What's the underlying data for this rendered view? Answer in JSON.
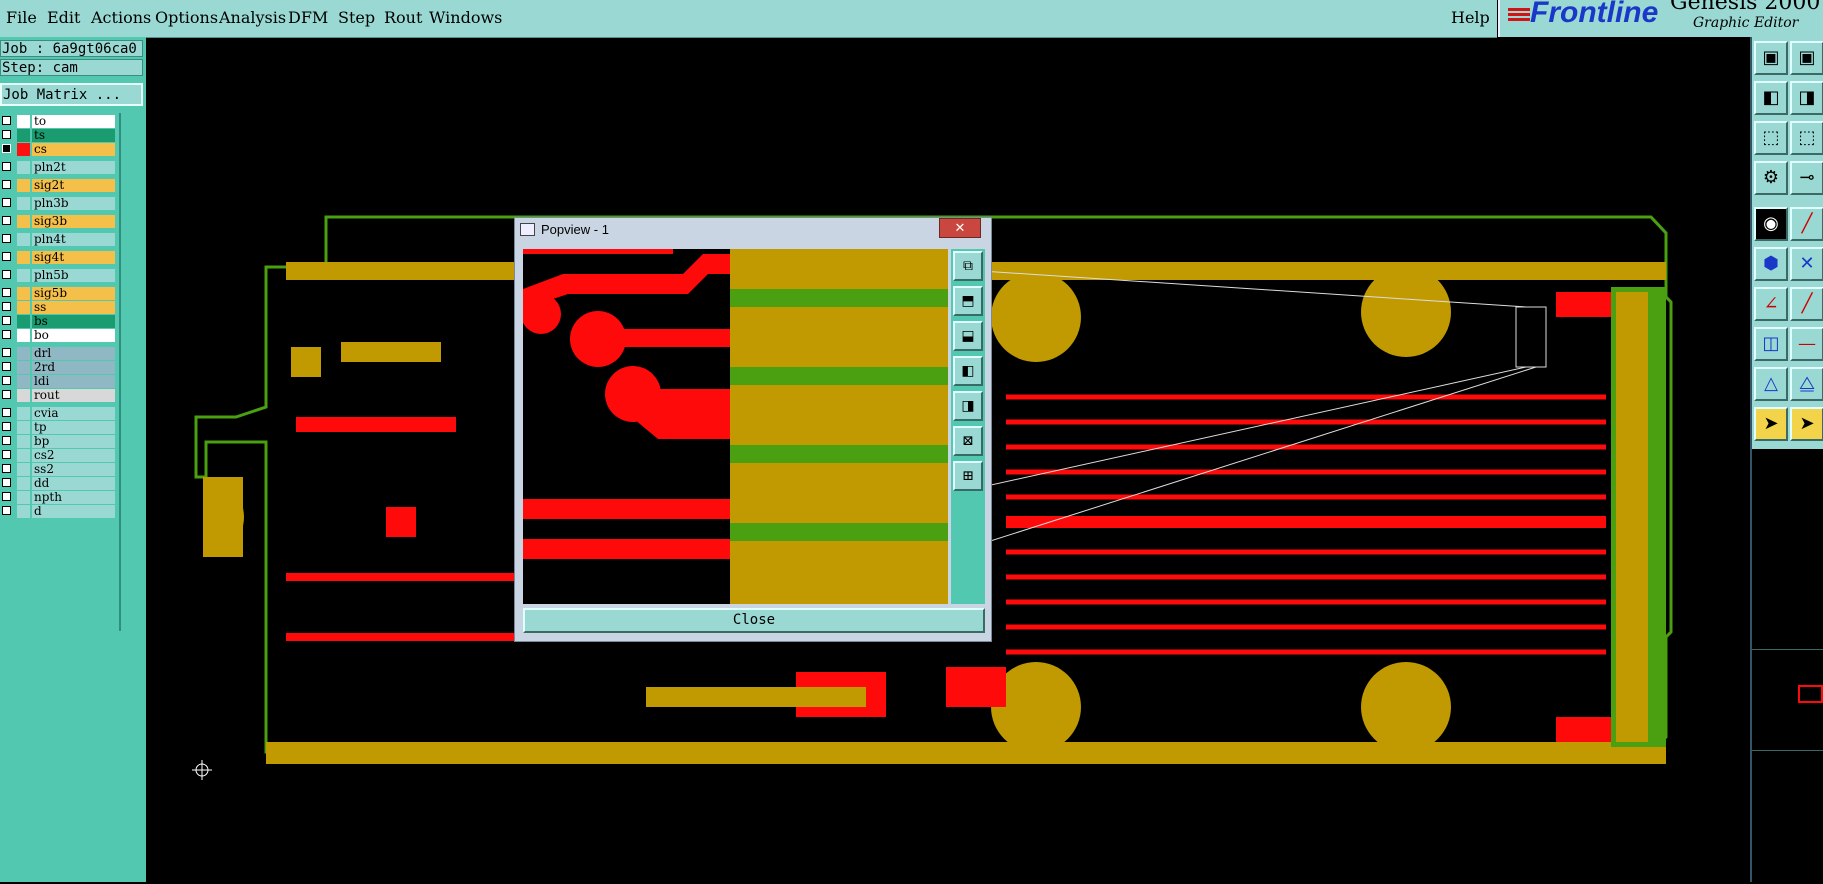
{
  "menu": {
    "items": [
      "File",
      "Edit",
      "Actions",
      "Options",
      "Analysis",
      "DFM",
      "Step",
      "Rout",
      "Windows"
    ],
    "help": "Help"
  },
  "logo": {
    "brand": "Frontline",
    "product": "Genesis 2000",
    "subtitle": "Graphic Editor"
  },
  "job": {
    "job_label": "Job : 6a9gt06ca0",
    "step_label": "Step: cam",
    "matrix_button": "Job Matrix ..."
  },
  "layers": [
    {
      "name": "to",
      "bg": "#ffffff",
      "swatch": "",
      "checked": false
    },
    {
      "name": "ts",
      "bg": "#1a9c70",
      "swatch": "#1a9c70",
      "checked": false
    },
    {
      "name": "cs",
      "bg": "#f5c04a",
      "swatch": "#ff1010",
      "checked": true
    },
    {
      "name": "pln2t",
      "bg": "#9ad9d3",
      "swatch": "",
      "checked": false
    },
    {
      "name": "sig2t",
      "bg": "#f5c04a",
      "swatch": "",
      "checked": false
    },
    {
      "name": "pln3b",
      "bg": "#9ad9d3",
      "swatch": "",
      "checked": false
    },
    {
      "name": "sig3b",
      "bg": "#f5c04a",
      "swatch": "",
      "checked": false
    },
    {
      "name": "pln4t",
      "bg": "#9ad9d3",
      "swatch": "",
      "checked": false
    },
    {
      "name": "sig4t",
      "bg": "#f5c04a",
      "swatch": "",
      "checked": false
    },
    {
      "name": "pln5b",
      "bg": "#9ad9d3",
      "swatch": "",
      "checked": false
    },
    {
      "name": "sig5b",
      "bg": "#f5c04a",
      "swatch": "",
      "checked": false
    },
    {
      "name": "ss",
      "bg": "#f5c04a",
      "swatch": "",
      "checked": false
    },
    {
      "name": "bs",
      "bg": "#1a9c70",
      "swatch": "",
      "checked": false
    },
    {
      "name": "bo",
      "bg": "#ffffff",
      "swatch": "",
      "checked": false
    },
    {
      "name": "drl",
      "bg": "#8fb8c4",
      "swatch": "",
      "checked": false
    },
    {
      "name": "2rd",
      "bg": "#8fb8c4",
      "swatch": "",
      "checked": false
    },
    {
      "name": "ldi",
      "bg": "#8fb8c4",
      "swatch": "",
      "checked": false
    },
    {
      "name": "rout",
      "bg": "#d8d8d8",
      "swatch": "",
      "checked": false
    },
    {
      "name": "cvia",
      "bg": "#9ad9d3",
      "swatch": "",
      "checked": false
    },
    {
      "name": "tp",
      "bg": "#9ad9d3",
      "swatch": "",
      "checked": false
    },
    {
      "name": "bp",
      "bg": "#9ad9d3",
      "swatch": "",
      "checked": false
    },
    {
      "name": "cs2",
      "bg": "#9ad9d3",
      "swatch": "",
      "checked": false
    },
    {
      "name": "ss2",
      "bg": "#9ad9d3",
      "swatch": "",
      "checked": false
    },
    {
      "name": "dd",
      "bg": "#9ad9d3",
      "swatch": "",
      "checked": false
    },
    {
      "name": "npth",
      "bg": "#9ad9d3",
      "swatch": "",
      "checked": false
    },
    {
      "name": "d",
      "bg": "#9ad9d3",
      "swatch": "",
      "checked": false
    }
  ],
  "popview": {
    "title": "Popview - 1",
    "close_label": "Close",
    "close_x": "✕"
  },
  "colors": {
    "copper": "#c09a00",
    "trace": "#ff0a0a",
    "mask": "#4aa010",
    "background": "#000000",
    "panel": "#52c8b0",
    "menu": "#9ad9d3"
  }
}
